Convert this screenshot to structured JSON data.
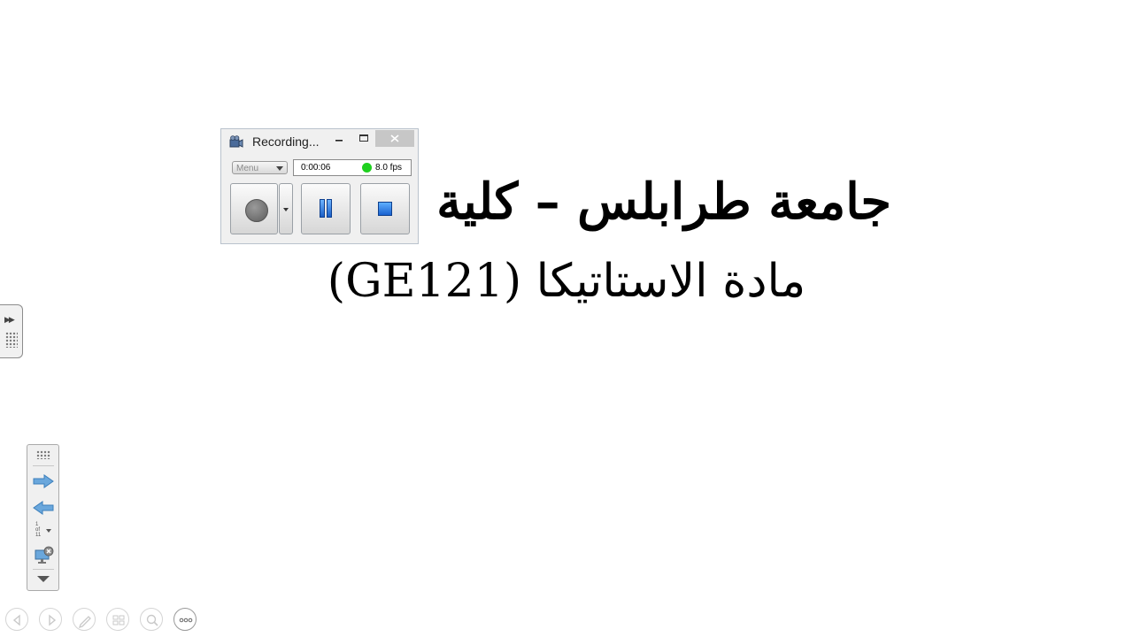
{
  "slide": {
    "line1": "جامعة طرابلس – كلية",
    "line2": "مادة الاستاتيكا (GE121)"
  },
  "recorder": {
    "title": "Recording...",
    "menu_label": "Menu",
    "elapsed": "0:00:06",
    "fps": "8.0 fps",
    "status_color": "#1fd01f",
    "buttons": [
      "record",
      "record-options",
      "pause",
      "stop"
    ]
  },
  "presenter_toolbar": {
    "page_current": "1",
    "page_of": "of",
    "page_total": "11"
  },
  "bottom_controls": [
    "previous",
    "next",
    "pen",
    "slides",
    "zoom",
    "more"
  ]
}
